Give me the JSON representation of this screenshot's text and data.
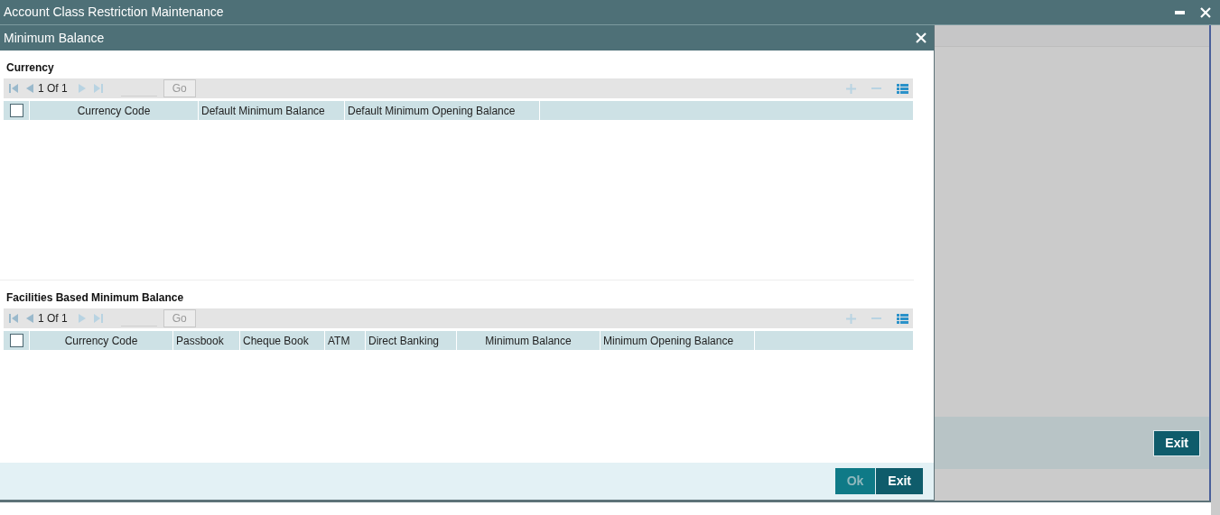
{
  "window": {
    "title": "Account Class Restriction Maintenance"
  },
  "background": {
    "exit_button": "Exit"
  },
  "dialog": {
    "title": "Minimum Balance",
    "sections": [
      {
        "title": "Currency",
        "pager": {
          "page": "1",
          "of": "Of",
          "total": "1"
        },
        "go": "Go",
        "select_all": {
          "checked": false
        },
        "columns": [
          "Currency Code",
          "Default Minimum Balance",
          "Default Minimum Opening Balance"
        ]
      },
      {
        "title": "Facilities Based Minimum Balance",
        "pager": {
          "page": "1",
          "of": "Of",
          "total": "1"
        },
        "go": "Go",
        "select_all": {
          "checked": false
        },
        "columns": [
          "Currency Code",
          "Passbook",
          "Cheque Book",
          "ATM",
          "Direct Banking",
          "Minimum Balance",
          "Minimum Opening Balance"
        ]
      }
    ],
    "buttons": [
      {
        "label": "Ok",
        "disabled": true
      },
      {
        "label": "Exit",
        "disabled": false
      }
    ]
  }
}
